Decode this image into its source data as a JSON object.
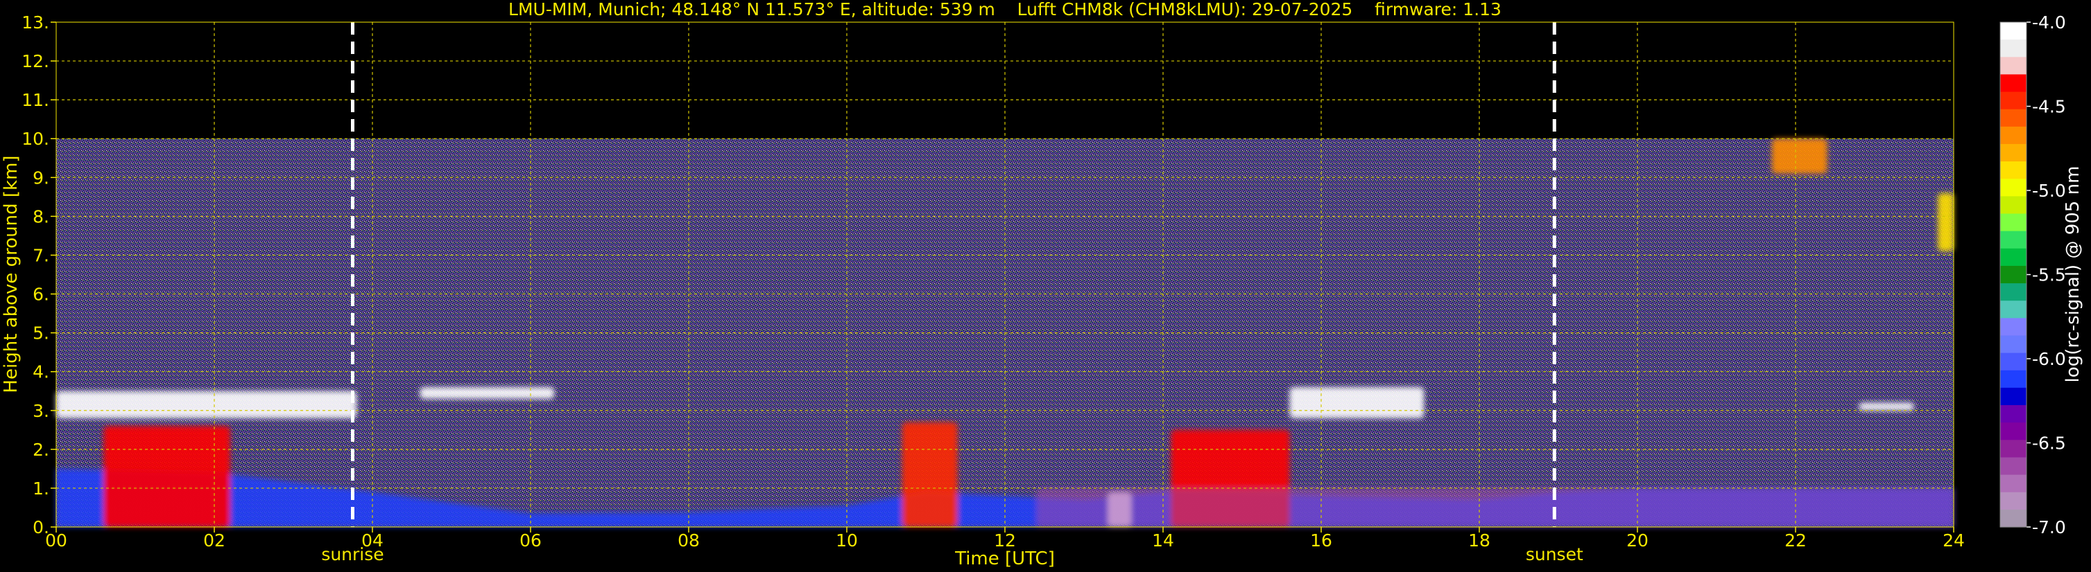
{
  "chart_data": {
    "type": "heatmap",
    "title": "LMU-MIM, Munich; 48.148° N 11.573° E, altitude: 539 m    Lufft CHM8k (CHM8kLMU): 29-07-2025    firmware: 1.13",
    "xlabel": "Time [UTC]",
    "ylabel": "Height above ground [km]",
    "xlim": [
      0,
      24
    ],
    "ylim": [
      0,
      13
    ],
    "x_tick_labels": [
      "00",
      "02",
      "04",
      "06",
      "08",
      "10",
      "12",
      "14",
      "16",
      "18",
      "20",
      "22",
      "24"
    ],
    "y_tick_labels": [
      "0.",
      "1.",
      "2.",
      "3.",
      "4.",
      "5.",
      "6.",
      "7.",
      "8.",
      "9.",
      "10.",
      "11.",
      "12.",
      "13."
    ],
    "grid": true,
    "signal_ceiling_km": 10,
    "events": [
      {
        "label": "sunrise",
        "time_utc": 3.75
      },
      {
        "label": "sunset",
        "time_utc": 18.95
      }
    ],
    "colorbar": {
      "label": "log(rc-signal) @ 905 nm",
      "range": [
        -7.0,
        -4.0
      ],
      "tick_labels": [
        "-4.0",
        "-4.5",
        "-5.0",
        "-5.5",
        "-6.0",
        "-6.5",
        "-7.0"
      ],
      "colors": [
        "#ffffff",
        "#eeeeee",
        "#f6c9c9",
        "#ff0000",
        "#ff2a00",
        "#ff5a00",
        "#ff8c00",
        "#ffb000",
        "#ffe000",
        "#f0ff00",
        "#c8f000",
        "#80ff40",
        "#30e060",
        "#00c040",
        "#109010",
        "#10a878",
        "#50c8b8",
        "#8080ff",
        "#6a7aff",
        "#4a5aff",
        "#2040ff",
        "#0000d0",
        "#6a00b0",
        "#8000a0",
        "#90209a",
        "#a04aa8",
        "#b070b8",
        "#b890c0",
        "#a898b0"
      ]
    },
    "features": [
      {
        "type": "boundary_layer",
        "x": [
          0,
          2,
          4,
          6,
          8,
          10,
          11,
          12,
          13,
          14,
          16,
          18,
          19,
          20,
          22,
          24
        ],
        "y": [
          1.5,
          1.4,
          0.9,
          0.35,
          0.38,
          0.55,
          0.9,
          0.8,
          0.7,
          0.9,
          0.8,
          0.7,
          0.9,
          1.0,
          1.0,
          1.0
        ],
        "color": "#2040ff"
      },
      {
        "type": "cloud",
        "x": [
          0.6,
          2.2
        ],
        "y": [
          0,
          2.6
        ],
        "color": "#ff0000"
      },
      {
        "type": "cloud",
        "x": [
          10.7,
          11.4
        ],
        "y": [
          0,
          2.7
        ],
        "color": "#ff2a00"
      },
      {
        "type": "cloud",
        "x": [
          13.3,
          13.6
        ],
        "y": [
          0,
          0.9
        ],
        "color": "#ffffff"
      },
      {
        "type": "cloud",
        "x": [
          14.1,
          15.6
        ],
        "y": [
          0,
          2.5
        ],
        "color": "#ff0000"
      },
      {
        "type": "cloud",
        "x": [
          21.7,
          22.4
        ],
        "y": [
          9.1,
          10.0
        ],
        "color": "#ff8c00"
      },
      {
        "type": "cloud",
        "x": [
          23.8,
          24.0
        ],
        "y": [
          7.1,
          8.6
        ],
        "color": "#ffe000"
      },
      {
        "type": "cloud_layer",
        "x": [
          0,
          3.8
        ],
        "y": [
          2.8,
          3.5
        ],
        "color": "#ffffff"
      },
      {
        "type": "cloud_layer",
        "x": [
          4.6,
          6.3
        ],
        "y": [
          3.3,
          3.6
        ],
        "color": "#ffffff"
      },
      {
        "type": "cloud_layer",
        "x": [
          15.6,
          17.3
        ],
        "y": [
          2.8,
          3.6
        ],
        "color": "#ffffff"
      },
      {
        "type": "cloud_layer",
        "x": [
          22.8,
          23.5
        ],
        "y": [
          3.0,
          3.2
        ],
        "color": "#ffffff"
      },
      {
        "type": "aerosol_layer",
        "x": [
          12.4,
          24
        ],
        "y": [
          0,
          1.0
        ],
        "color": "#a04aa8"
      }
    ]
  }
}
